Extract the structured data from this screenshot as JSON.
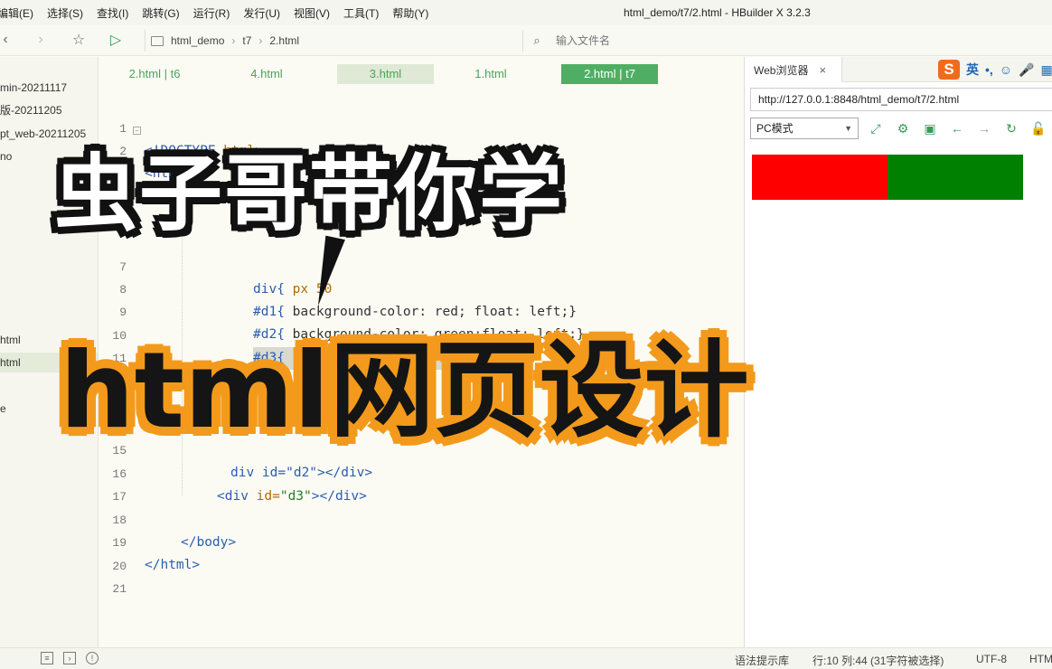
{
  "menubar": {
    "items": [
      "编辑(E)",
      "选择(S)",
      "查找(I)",
      "跳转(G)",
      "运行(R)",
      "发行(U)",
      "视图(V)",
      "工具(T)",
      "帮助(Y)"
    ],
    "window_title": "html_demo/t7/2.html - HBuilder X 3.2.3"
  },
  "toolbar": {
    "breadcrumb": [
      "html_demo",
      "t7",
      "2.html"
    ],
    "file_search_placeholder": "输入文件名"
  },
  "sidebar": {
    "items": [
      "min-20211117",
      "版-20211205",
      "pt_web-20211205",
      "no",
      "html",
      "html",
      "e"
    ]
  },
  "editor": {
    "tabs": [
      "2.html | t6",
      "4.html",
      "3.html",
      "1.html",
      "2.html | t7"
    ],
    "line_numbers": [
      "1",
      "2",
      "7",
      "8",
      "9",
      "10",
      "11",
      "15",
      "16",
      "17",
      "18",
      "19",
      "20",
      "21"
    ],
    "code": {
      "l1a": "<!DOCTYPE",
      "l1b": " html",
      "l1c": ">",
      "l2": "<html>",
      "l7a": "div{",
      "l7b": " ",
      "l7c": "px",
      "l7d": " 50",
      "l8a": "#d1{",
      "l8b": " background-color: red; float: left;}",
      "l9a": "#d2{",
      "l9b": " background-color: green;float: left;}",
      "l10a": "#d3{",
      "l10b": "  background",
      "l11": "tyle>",
      "l15": "div id=\"d2\"></div>",
      "l16a": "<div",
      "l16b": " id=",
      "l16c": "\"d3\"",
      "l16d": "></div>",
      "l18": "</body>",
      "l19": "</html>"
    }
  },
  "browser": {
    "tab_label": "Web浏览器",
    "close": "×",
    "ime_logo": "S",
    "ime_items": [
      "英",
      "•,",
      "☺",
      "🎤",
      "▦"
    ],
    "url": "http://127.0.0.1:8848/html_demo/t7/2.html",
    "mode": "PC模式",
    "preview": {
      "d1_color": "#ff0000",
      "d2_color": "#008000"
    }
  },
  "statusbar": {
    "hint": "语法提示库",
    "position": "行:10  列:44 (31字符被选择)",
    "encoding": "UTF-8",
    "language": "HTM"
  },
  "overlay": {
    "line1": "虫子哥带你学",
    "line2": "html网页设计"
  }
}
